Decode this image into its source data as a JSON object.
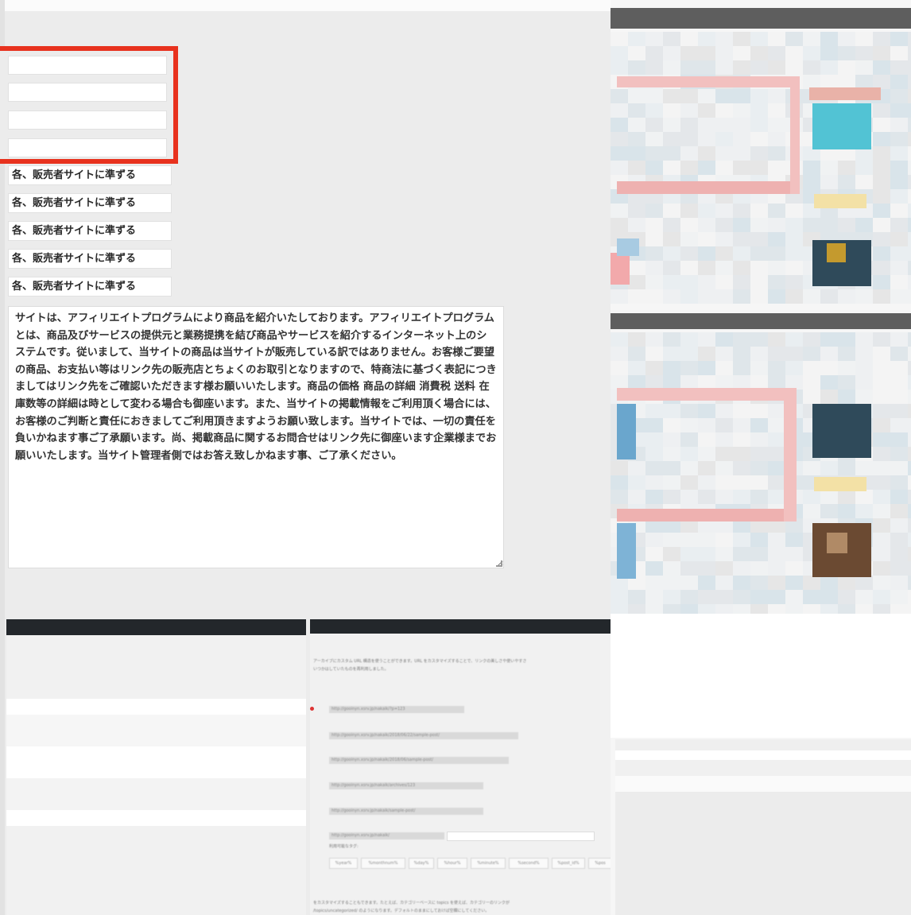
{
  "form": {
    "blank_inputs_highlighted": true,
    "highlight_color": "#e8321e",
    "text_fields": [
      "各、販売者サイトに準ずる",
      "各、販売者サイトに準ずる",
      "各、販売者サイトに準ずる",
      "各、販売者サイトに準ずる",
      "各、販売者サイトに準ずる"
    ],
    "disclaimer": "サイトは、アフィリエイトプログラムにより商品を紹介いたしております。アフィリエイトプログラムとは、商品及びサービスの提供元と業務提携を結び商品やサービスを紹介するインターネット上のシステムです。従いまして、当サイトの商品は当サイトが販売している訳ではありません。お客様ご要望の商品、お支払い等はリンク先の販売店とちょくのお取引となりますので、特商法に基づく表記につきましてはリンク先をご確認いただきます様お願いいたします。商品の価格 商品の詳細 消費税 送料 在庫数等の詳細は時として変わる場合も御座います。また、当サイトの掲載情報をご利用頂く場合には、お客様のご判断と責任におきましてご利用頂きますようお願い致します。当サイトでは、一切の責任を負いかねます事ご了承願います。尚、掲載商品に関するお問合せはリンク先に御座います企業様までお願いいたします。当サイト管理者側ではお答え致しかねます事、ご了承ください。"
  },
  "permalinks": {
    "intro": "アーカイブにカスタム URL 構造を使うことができます。URL をカスタマイズすることで、リンクの美しさや使いやすさ",
    "intro2": "いつかはしていたものを再利用しました。",
    "options": [
      "http://gooinyn.xsrv.jp/nakaik/?p=123",
      "http://gooinyn.xsrv.jp/nakaik/2018/06/22/sample-post/",
      "http://gooinyn.xsrv.jp/nakaik/2018/06/sample-post/",
      "http://gooinyn.xsrv.jp/nakaik/archives/123",
      "http://gooinyn.xsrv.jp/nakaik/sample-post/",
      "http://gooinyn.xsrv.jp/nakaik/"
    ],
    "available_tags_label": "利用可能なタグ:",
    "tags": [
      "%year%",
      "%monthnum%",
      "%day%",
      "%hour%",
      "%minute%",
      "%second%",
      "%post_id%",
      "%pos"
    ],
    "footer": "をカスタマイズすることもできます。たとえば、カテゴリーベースに topics を使えば、カテゴリーのリンクが",
    "footer2": "/topics/uncategorized/ のようになります。デフォルトのままにしておけば空欄にしてください。"
  }
}
